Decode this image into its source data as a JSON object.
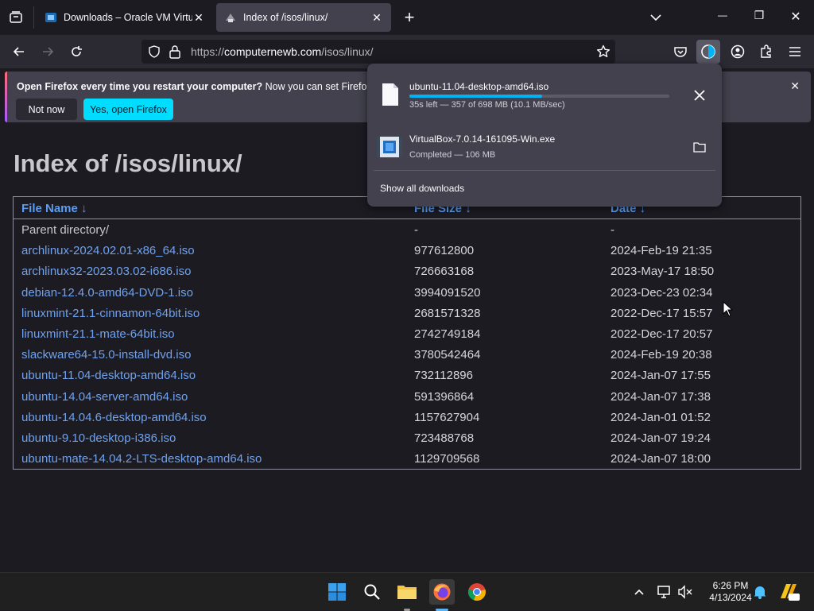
{
  "tabs": [
    {
      "title": "Downloads – Oracle VM VirtualBox",
      "close": "✕"
    },
    {
      "title": "Index of /isos/linux/",
      "close": "✕"
    }
  ],
  "new_tab": "+",
  "window_controls": {
    "minimize": "—",
    "restore": "❐",
    "close": "✕"
  },
  "urlbar": {
    "scheme": "https://",
    "host": "computernewb.com",
    "path": "/isos/linux/"
  },
  "notification": {
    "bold": "Open Firefox every time you restart your computer?",
    "text": " Now you can set Firefox to o",
    "not_now": "Not now",
    "yes": "Yes, open Firefox",
    "close": "✕"
  },
  "page": {
    "title": "Index of /isos/linux/",
    "columns": [
      "File Name  ↓",
      "File Size  ↓",
      "Date  ↓"
    ],
    "rows": [
      [
        "Parent directory/",
        "-",
        "-"
      ],
      [
        "archlinux-2024.02.01-x86_64.iso",
        "977612800",
        "2024-Feb-19 21:35"
      ],
      [
        "archlinux32-2023.03.02-i686.iso",
        "726663168",
        "2023-May-17 18:50"
      ],
      [
        "debian-12.4.0-amd64-DVD-1.iso",
        "3994091520",
        "2023-Dec-23 02:34"
      ],
      [
        "linuxmint-21.1-cinnamon-64bit.iso",
        "2681571328",
        "2022-Dec-17 15:57"
      ],
      [
        "linuxmint-21.1-mate-64bit.iso",
        "2742749184",
        "2022-Dec-17 20:57"
      ],
      [
        "slackware64-15.0-install-dvd.iso",
        "3780542464",
        "2024-Feb-19 20:38"
      ],
      [
        "ubuntu-11.04-desktop-amd64.iso",
        "732112896",
        "2024-Jan-07 17:55"
      ],
      [
        "ubuntu-14.04-server-amd64.iso",
        "591396864",
        "2024-Jan-07 17:38"
      ],
      [
        "ubuntu-14.04.6-desktop-amd64.iso",
        "1157627904",
        "2024-Jan-01 01:52"
      ],
      [
        "ubuntu-9.10-desktop-i386.iso",
        "723488768",
        "2024-Jan-07 19:24"
      ],
      [
        "ubuntu-mate-14.04.2-LTS-desktop-amd64.iso",
        "1129709568",
        "2024-Jan-07 18:00"
      ]
    ]
  },
  "downloads": {
    "items": [
      {
        "name": "ubuntu-11.04-desktop-amd64.iso",
        "status": "35s left — 357 of 698 MB (10.1 MB/sec)",
        "progress": 0.511
      },
      {
        "name": "VirtualBox-7.0.14-161095-Win.exe",
        "status": "Completed — 106 MB"
      }
    ],
    "show_all": "Show all downloads"
  },
  "taskbar": {
    "time": "6:26 PM",
    "date": "4/13/2024"
  },
  "colors": {
    "accent": "#00ddff",
    "link": "#6fa2ee",
    "progress": "#00b3f4"
  }
}
